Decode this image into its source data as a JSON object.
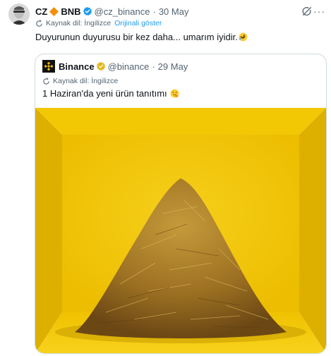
{
  "tweet": {
    "author_name": "CZ",
    "author_tag": "BNB",
    "handle": "@cz_binance",
    "separator": "·",
    "date": "30 May",
    "translate_source": "Kaynak dil: İngilizce",
    "show_original": "Orijinali göster",
    "text": "Duyurunun duyurusu bir kez daha... umarım iyidir.",
    "more": "···"
  },
  "quote": {
    "author_name": "Binance",
    "handle": "@binance",
    "separator": "·",
    "date": "29 May",
    "translate_source": "Kaynak dil: İngilizce",
    "text": "1 Haziran'da yeni ürün tanıtımı"
  },
  "colors": {
    "accent": "#1d9bf0",
    "muted": "#536471",
    "gold_badge": "#f0b90b",
    "image_yellow": "#f2c400",
    "bnb_orange": "#f28f0c"
  },
  "icons": {
    "diamond": "orange-diamond-icon",
    "verified": "verified-badge-icon",
    "grok": "grok-icon",
    "translate": "translate-icon",
    "laugh": "rolling-laughing-emoji",
    "hmm": "shushing-face-emoji"
  }
}
